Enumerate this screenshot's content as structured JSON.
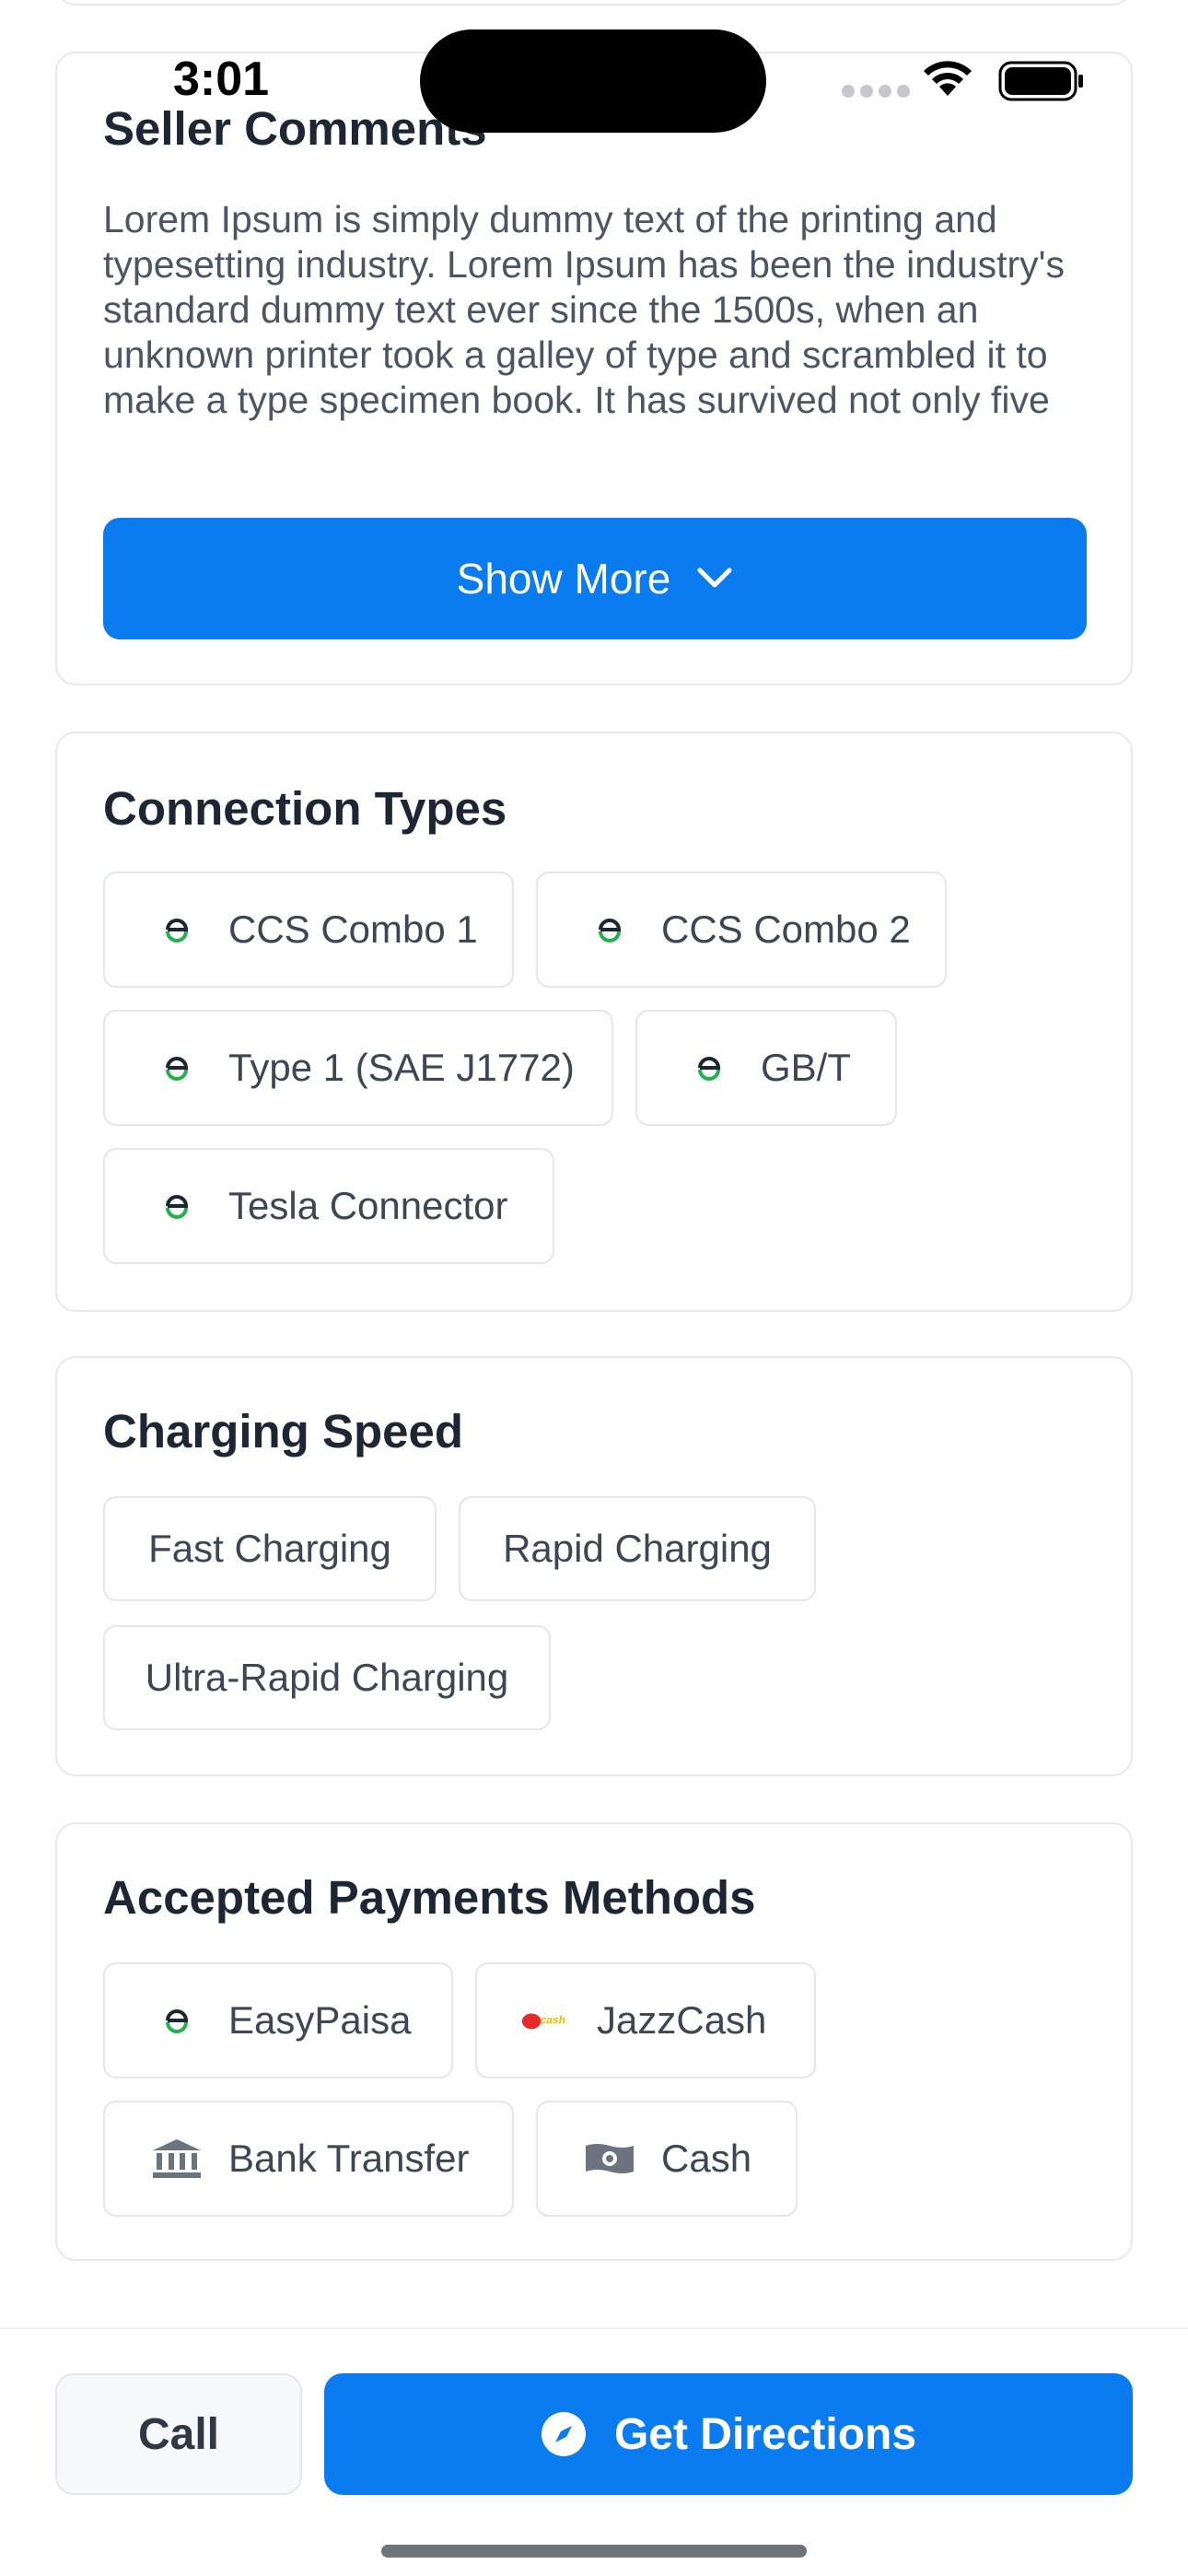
{
  "status_bar": {
    "time": "3:01"
  },
  "seller_comments": {
    "title": "Seller Comments",
    "text": "Lorem Ipsum is simply dummy text of the printing and typesetting industry. Lorem Ipsum has been the industry's standard dummy text ever since the 1500s, when an unknown printer took a galley of type and scrambled it to make a type specimen book. It has survived not only five",
    "show_more_label": "Show More"
  },
  "connection_types": {
    "title": "Connection Types",
    "items": [
      "CCS Combo 1",
      "CCS Combo 2",
      "Type 1 (SAE J1772)",
      "GB/T",
      "Tesla Connector"
    ]
  },
  "charging_speed": {
    "title": "Charging Speed",
    "items": [
      "Fast Charging",
      "Rapid Charging",
      "Ultra-Rapid Charging"
    ]
  },
  "payment_methods": {
    "title": "Accepted Payments Methods",
    "items": [
      {
        "label": "EasyPaisa",
        "icon": "easypaisa-icon"
      },
      {
        "label": "JazzCash",
        "icon": "jazzcash-icon"
      },
      {
        "label": "Bank Transfer",
        "icon": "bank-icon"
      },
      {
        "label": "Cash",
        "icon": "cash-icon"
      }
    ]
  },
  "actions": {
    "call_label": "Call",
    "directions_label": "Get Directions"
  },
  "colors": {
    "primary": "#0a7cf0",
    "connector_green": "#22b14c",
    "text_dark": "#1d2634",
    "text_muted": "#4b5566"
  }
}
